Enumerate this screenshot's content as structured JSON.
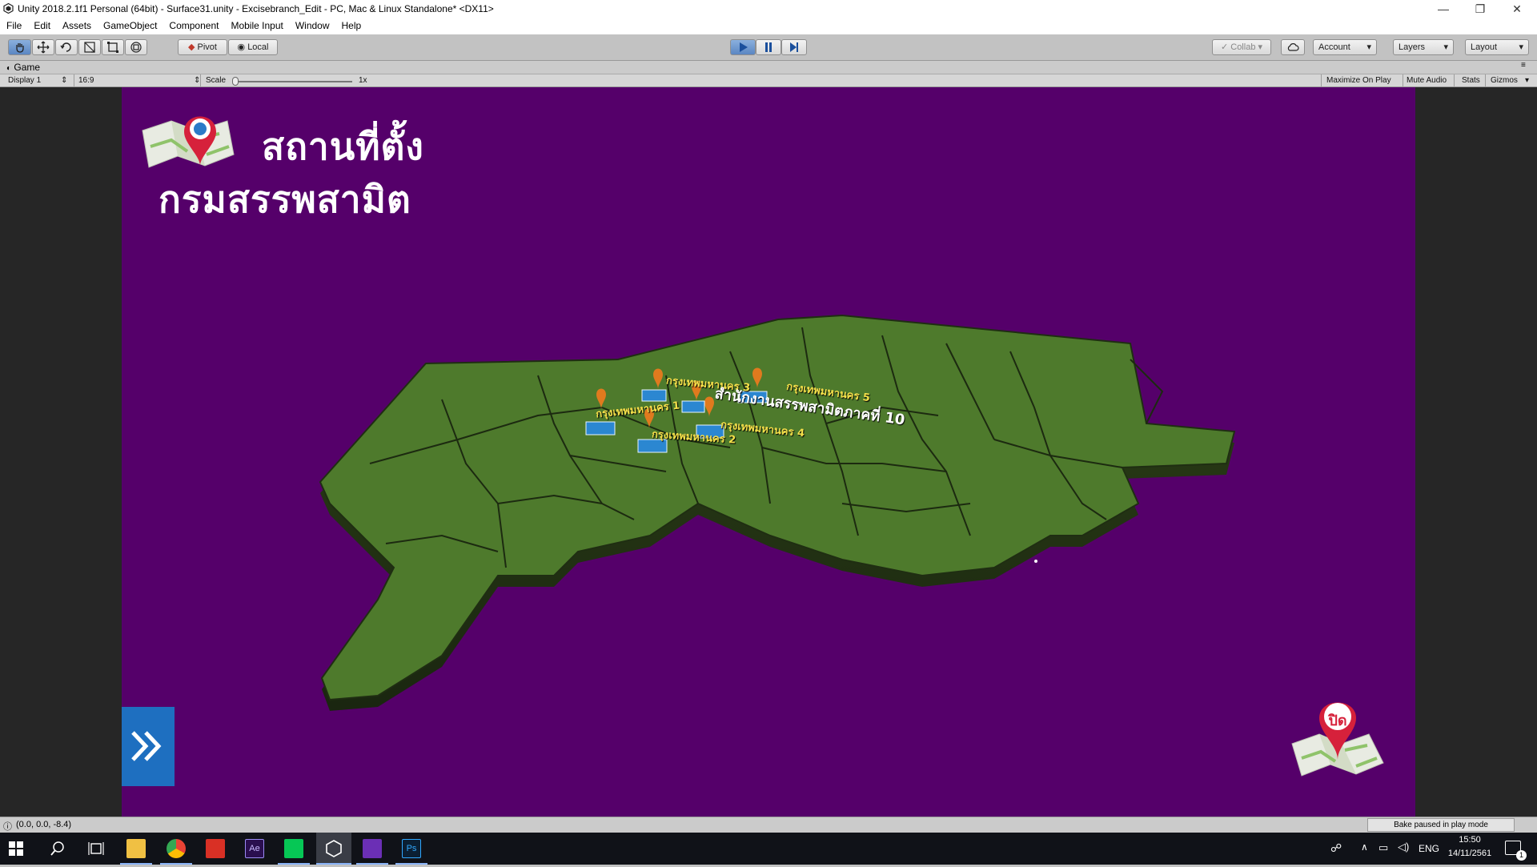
{
  "window": {
    "title": "Unity 2018.2.1f1 Personal (64bit) - Surface31.unity - Excisebranch_Edit - PC, Mac & Linux Standalone* <DX11>",
    "controls": {
      "minimize": "—",
      "restore": "❐",
      "close": "✕"
    }
  },
  "menu": {
    "items": [
      "File",
      "Edit",
      "Assets",
      "GameObject",
      "Component",
      "Mobile Input",
      "Window",
      "Help"
    ]
  },
  "toolbar": {
    "pivot_label": "Pivot",
    "local_label": "Local",
    "collab_label": "Collab",
    "account_label": "Account",
    "layers_label": "Layers",
    "layout_label": "Layout"
  },
  "game_tab": {
    "label": "Game"
  },
  "game_options": {
    "display": "Display 1",
    "aspect": "16:9",
    "scale_label": "Scale",
    "scale_value": "1x",
    "maximize_on_play": "Maximize On Play",
    "mute_audio": "Mute Audio",
    "stats": "Stats",
    "gizmos": "Gizmos"
  },
  "game_view": {
    "title_line1": "สถานที่ตั้ง",
    "title_line2": "กรมสรรพสามิต",
    "labels": [
      {
        "text": "กรุงเทพมหานคร 1",
        "style": "yellow"
      },
      {
        "text": "กรุงเทพมหานคร 2",
        "style": "yellow"
      },
      {
        "text": "กรุงเทพมหานคร 3",
        "style": "yellow"
      },
      {
        "text": "กรุงเทพมหานคร 4",
        "style": "yellow"
      },
      {
        "text": "กรุงเทพมหานคร 5",
        "style": "yellow"
      },
      {
        "text": "สำนักงานสรรพสามิตภาคที่ 10",
        "style": "white"
      }
    ],
    "close_label": "ปิด",
    "colors": {
      "background": "#55006a",
      "map_green": "#4e7a2c",
      "next_button": "#1e6fc0"
    }
  },
  "status": {
    "coordinates": "(0.0, 0.0, -8.4)",
    "bake_message": "Bake paused in play mode"
  },
  "taskbar": {
    "apps": [
      "windows-start",
      "search",
      "task-view",
      "file-explorer",
      "chrome",
      "app-red",
      "after-effects",
      "line",
      "unity",
      "visual-studio",
      "photoshop"
    ],
    "language": "ENG",
    "time": "15:50",
    "date": "14/11/2561",
    "notification_count": "1"
  }
}
